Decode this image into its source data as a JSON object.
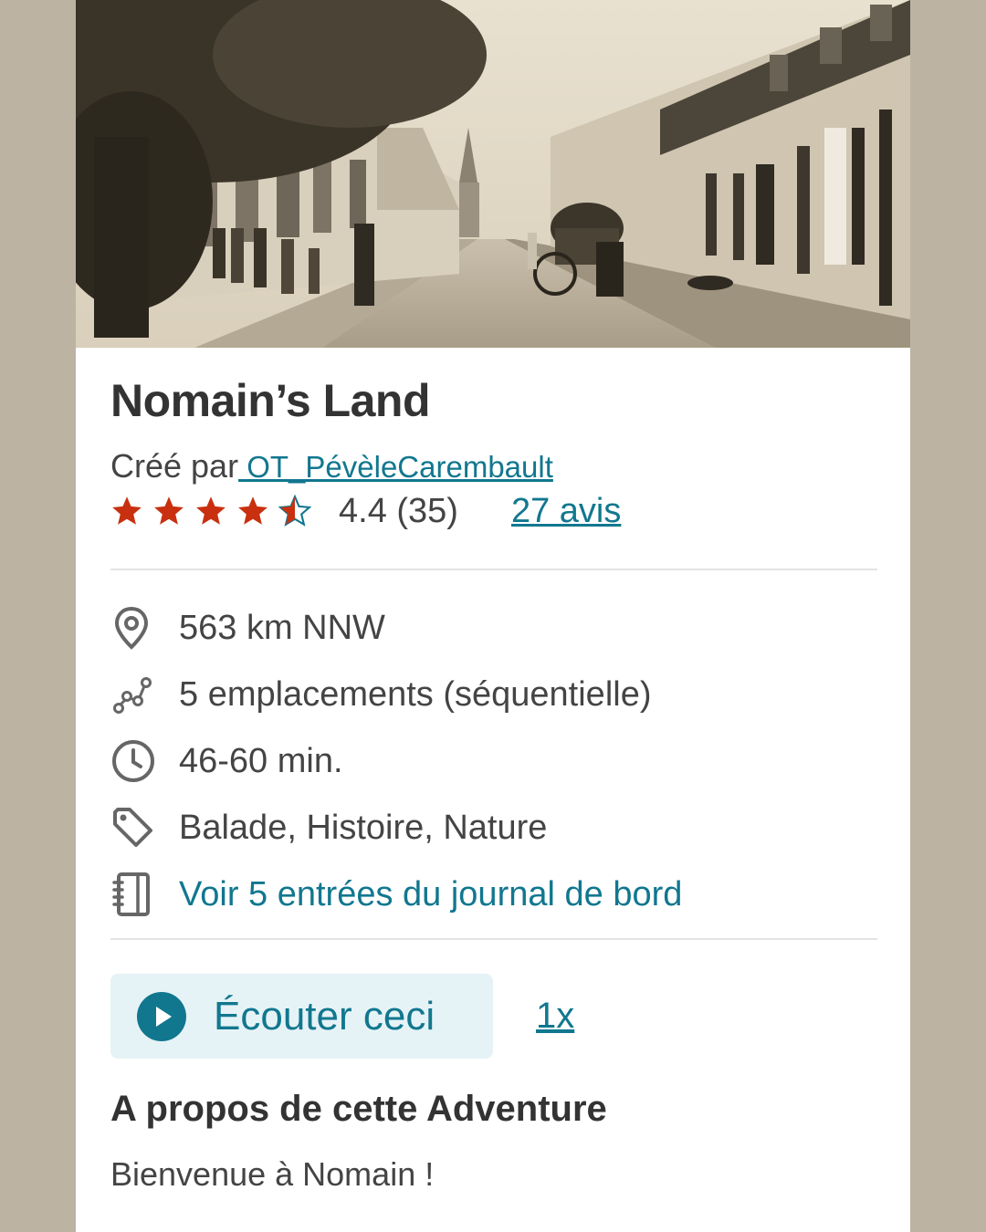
{
  "hero": {
    "image_description_icon": "vintage-street-photo"
  },
  "adventure": {
    "title": "Nomain’s Land",
    "created_by_label": "Créé par",
    "creator": " OT_PévèleCarembault",
    "rating": {
      "stars": 4.4,
      "stars_max": 5,
      "score_text": "4.4 (35)",
      "reviews_link": "27 avis"
    },
    "details": {
      "distance": "563 km NNW",
      "locations": "5 emplacements (séquentielle)",
      "duration": "46-60 min.",
      "tags": "Balade, Histoire, Nature",
      "journal_link": "Voir 5 entrées du journal de bord"
    },
    "audio": {
      "listen_label": "Écouter ceci",
      "speed_label": "1x"
    },
    "about": {
      "heading": "A propos de cette Adventure",
      "text": "Bienvenue à Nomain !"
    }
  },
  "colors": {
    "page_background": "#bcb3a3",
    "accent": "#11778f",
    "star": "#c8300f",
    "text": "#444444",
    "listen_background": "#e6f3f6"
  }
}
